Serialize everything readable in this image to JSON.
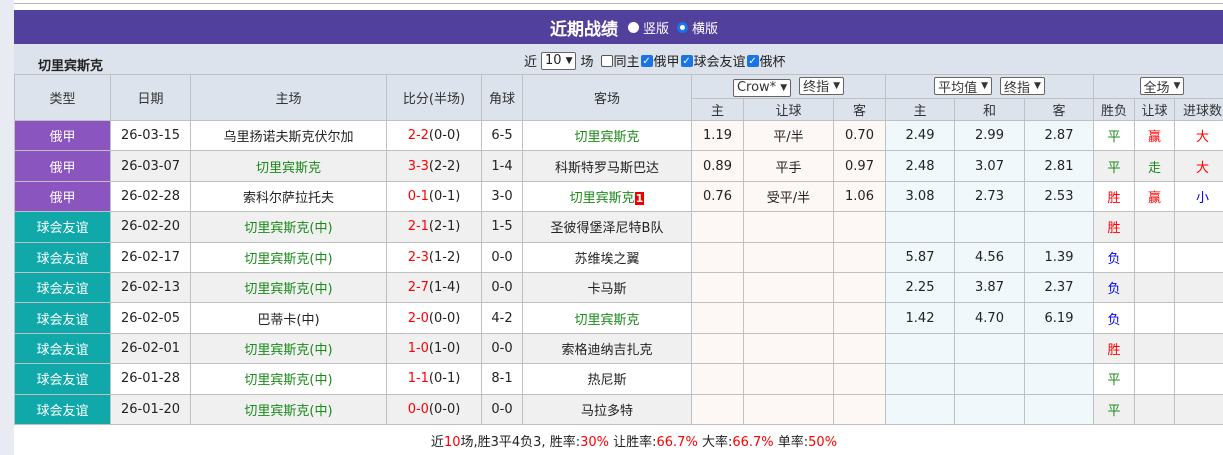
{
  "header": {
    "title": "近期战绩",
    "radio_vertical": "竖版",
    "radio_horizontal": "横版",
    "selected": "横版"
  },
  "filter": {
    "team": "切里宾斯克",
    "prefix": "近",
    "count": "10",
    "suffix": "场",
    "same_home": "同主",
    "same_home_checked": false,
    "leagues": [
      {
        "label": "俄甲",
        "checked": true
      },
      {
        "label": "球会友谊",
        "checked": true
      },
      {
        "label": "俄杯",
        "checked": true
      }
    ]
  },
  "columns": {
    "type": "类型",
    "date": "日期",
    "home": "主场",
    "score": "比分(半场)",
    "corner": "角球",
    "away": "客场",
    "crow_select": "Crow*",
    "crow_kind": "终指",
    "avg_select": "平均值",
    "avg_kind": "终指",
    "period_select": "全场",
    "sub": [
      "主",
      "让球",
      "客",
      "主",
      "和",
      "客",
      "胜负",
      "让球",
      "进球数"
    ]
  },
  "rows": [
    {
      "type": "俄甲",
      "kind": "league",
      "date": "26-03-15",
      "home": "乌里扬诺夫斯克伏尔加",
      "home_is_team": false,
      "score": "2-2",
      "half": "(0-0)",
      "corner": "6-5",
      "away": "切里宾斯克",
      "away_is_team": true,
      "badge": "",
      "c_home": "1.19",
      "c_line": "平/半",
      "c_away": "0.70",
      "a_home": "2.49",
      "a_draw": "2.99",
      "a_away": "2.87",
      "result": "平",
      "handicap": "赢",
      "goals": "大"
    },
    {
      "type": "俄甲",
      "kind": "league",
      "date": "26-03-07",
      "home": "切里宾斯克",
      "home_is_team": true,
      "score": "3-3",
      "half": "(2-2)",
      "corner": "1-4",
      "away": "科斯特罗马斯巴达",
      "away_is_team": false,
      "badge": "",
      "c_home": "0.89",
      "c_line": "平手",
      "c_away": "0.97",
      "a_home": "2.48",
      "a_draw": "3.07",
      "a_away": "2.81",
      "result": "平",
      "handicap": "走",
      "goals": "大"
    },
    {
      "type": "俄甲",
      "kind": "league",
      "date": "26-02-28",
      "home": "索科尔萨拉托夫",
      "home_is_team": false,
      "score": "0-1",
      "half": "(0-1)",
      "corner": "3-0",
      "away": "切里宾斯克",
      "away_is_team": true,
      "badge": "1",
      "c_home": "0.76",
      "c_line": "受平/半",
      "c_away": "1.06",
      "a_home": "3.08",
      "a_draw": "2.73",
      "a_away": "2.53",
      "result": "胜",
      "handicap": "赢",
      "goals": "小"
    },
    {
      "type": "球会友谊",
      "kind": "friendly",
      "date": "26-02-20",
      "home": "切里宾斯克(中)",
      "home_is_team": true,
      "score": "2-1",
      "half": "(2-1)",
      "corner": "1-5",
      "away": "圣彼得堡泽尼特B队",
      "away_is_team": false,
      "badge": "",
      "c_home": "",
      "c_line": "",
      "c_away": "",
      "a_home": "",
      "a_draw": "",
      "a_away": "",
      "result": "胜",
      "handicap": "",
      "goals": ""
    },
    {
      "type": "球会友谊",
      "kind": "friendly",
      "date": "26-02-17",
      "home": "切里宾斯克(中)",
      "home_is_team": true,
      "score": "2-3",
      "half": "(1-2)",
      "corner": "0-0",
      "away": "苏维埃之翼",
      "away_is_team": false,
      "badge": "",
      "c_home": "",
      "c_line": "",
      "c_away": "",
      "a_home": "5.87",
      "a_draw": "4.56",
      "a_away": "1.39",
      "result": "负",
      "handicap": "",
      "goals": ""
    },
    {
      "type": "球会友谊",
      "kind": "friendly",
      "date": "26-02-13",
      "home": "切里宾斯克(中)",
      "home_is_team": true,
      "score": "2-7",
      "half": "(1-4)",
      "corner": "0-0",
      "away": "卡马斯",
      "away_is_team": false,
      "badge": "",
      "c_home": "",
      "c_line": "",
      "c_away": "",
      "a_home": "2.25",
      "a_draw": "3.87",
      "a_away": "2.37",
      "result": "负",
      "handicap": "",
      "goals": ""
    },
    {
      "type": "球会友谊",
      "kind": "friendly",
      "date": "26-02-05",
      "home": "巴蒂卡(中)",
      "home_is_team": false,
      "score": "2-0",
      "half": "(0-0)",
      "corner": "4-2",
      "away": "切里宾斯克",
      "away_is_team": true,
      "badge": "",
      "c_home": "",
      "c_line": "",
      "c_away": "",
      "a_home": "1.42",
      "a_draw": "4.70",
      "a_away": "6.19",
      "result": "负",
      "handicap": "",
      "goals": ""
    },
    {
      "type": "球会友谊",
      "kind": "friendly",
      "date": "26-02-01",
      "home": "切里宾斯克(中)",
      "home_is_team": true,
      "score": "1-0",
      "half": "(1-0)",
      "corner": "0-0",
      "away": "索格迪纳吉扎克",
      "away_is_team": false,
      "badge": "",
      "c_home": "",
      "c_line": "",
      "c_away": "",
      "a_home": "",
      "a_draw": "",
      "a_away": "",
      "result": "胜",
      "handicap": "",
      "goals": ""
    },
    {
      "type": "球会友谊",
      "kind": "friendly",
      "date": "26-01-28",
      "home": "切里宾斯克(中)",
      "home_is_team": true,
      "score": "1-1",
      "half": "(0-1)",
      "corner": "8-1",
      "away": "热尼斯",
      "away_is_team": false,
      "badge": "",
      "c_home": "",
      "c_line": "",
      "c_away": "",
      "a_home": "",
      "a_draw": "",
      "a_away": "",
      "result": "平",
      "handicap": "",
      "goals": ""
    },
    {
      "type": "球会友谊",
      "kind": "friendly",
      "date": "26-01-20",
      "home": "切里宾斯克(中)",
      "home_is_team": true,
      "score": "0-0",
      "half": "(0-0)",
      "corner": "0-0",
      "away": "马拉多特",
      "away_is_team": false,
      "badge": "",
      "c_home": "",
      "c_line": "",
      "c_away": "",
      "a_home": "",
      "a_draw": "",
      "a_away": "",
      "result": "平",
      "handicap": "",
      "goals": ""
    }
  ],
  "footer": {
    "p1": "近",
    "n": "10",
    "p2": "场,胜3平4负3, 胜率:",
    "win": "30%",
    "p3": " 让胜率:",
    "hwin": "66.7%",
    "p4": " 大率:",
    "big": "66.7%",
    "p5": " 单率:",
    "odd": "50%"
  },
  "colors": {
    "header": "#51409c",
    "league": "#8b55c0",
    "friendly": "#10a8a8",
    "team": "#1a8a1a",
    "win": "#ff0000",
    "draw": "#1a8a1a",
    "loss": "#0000ff"
  }
}
